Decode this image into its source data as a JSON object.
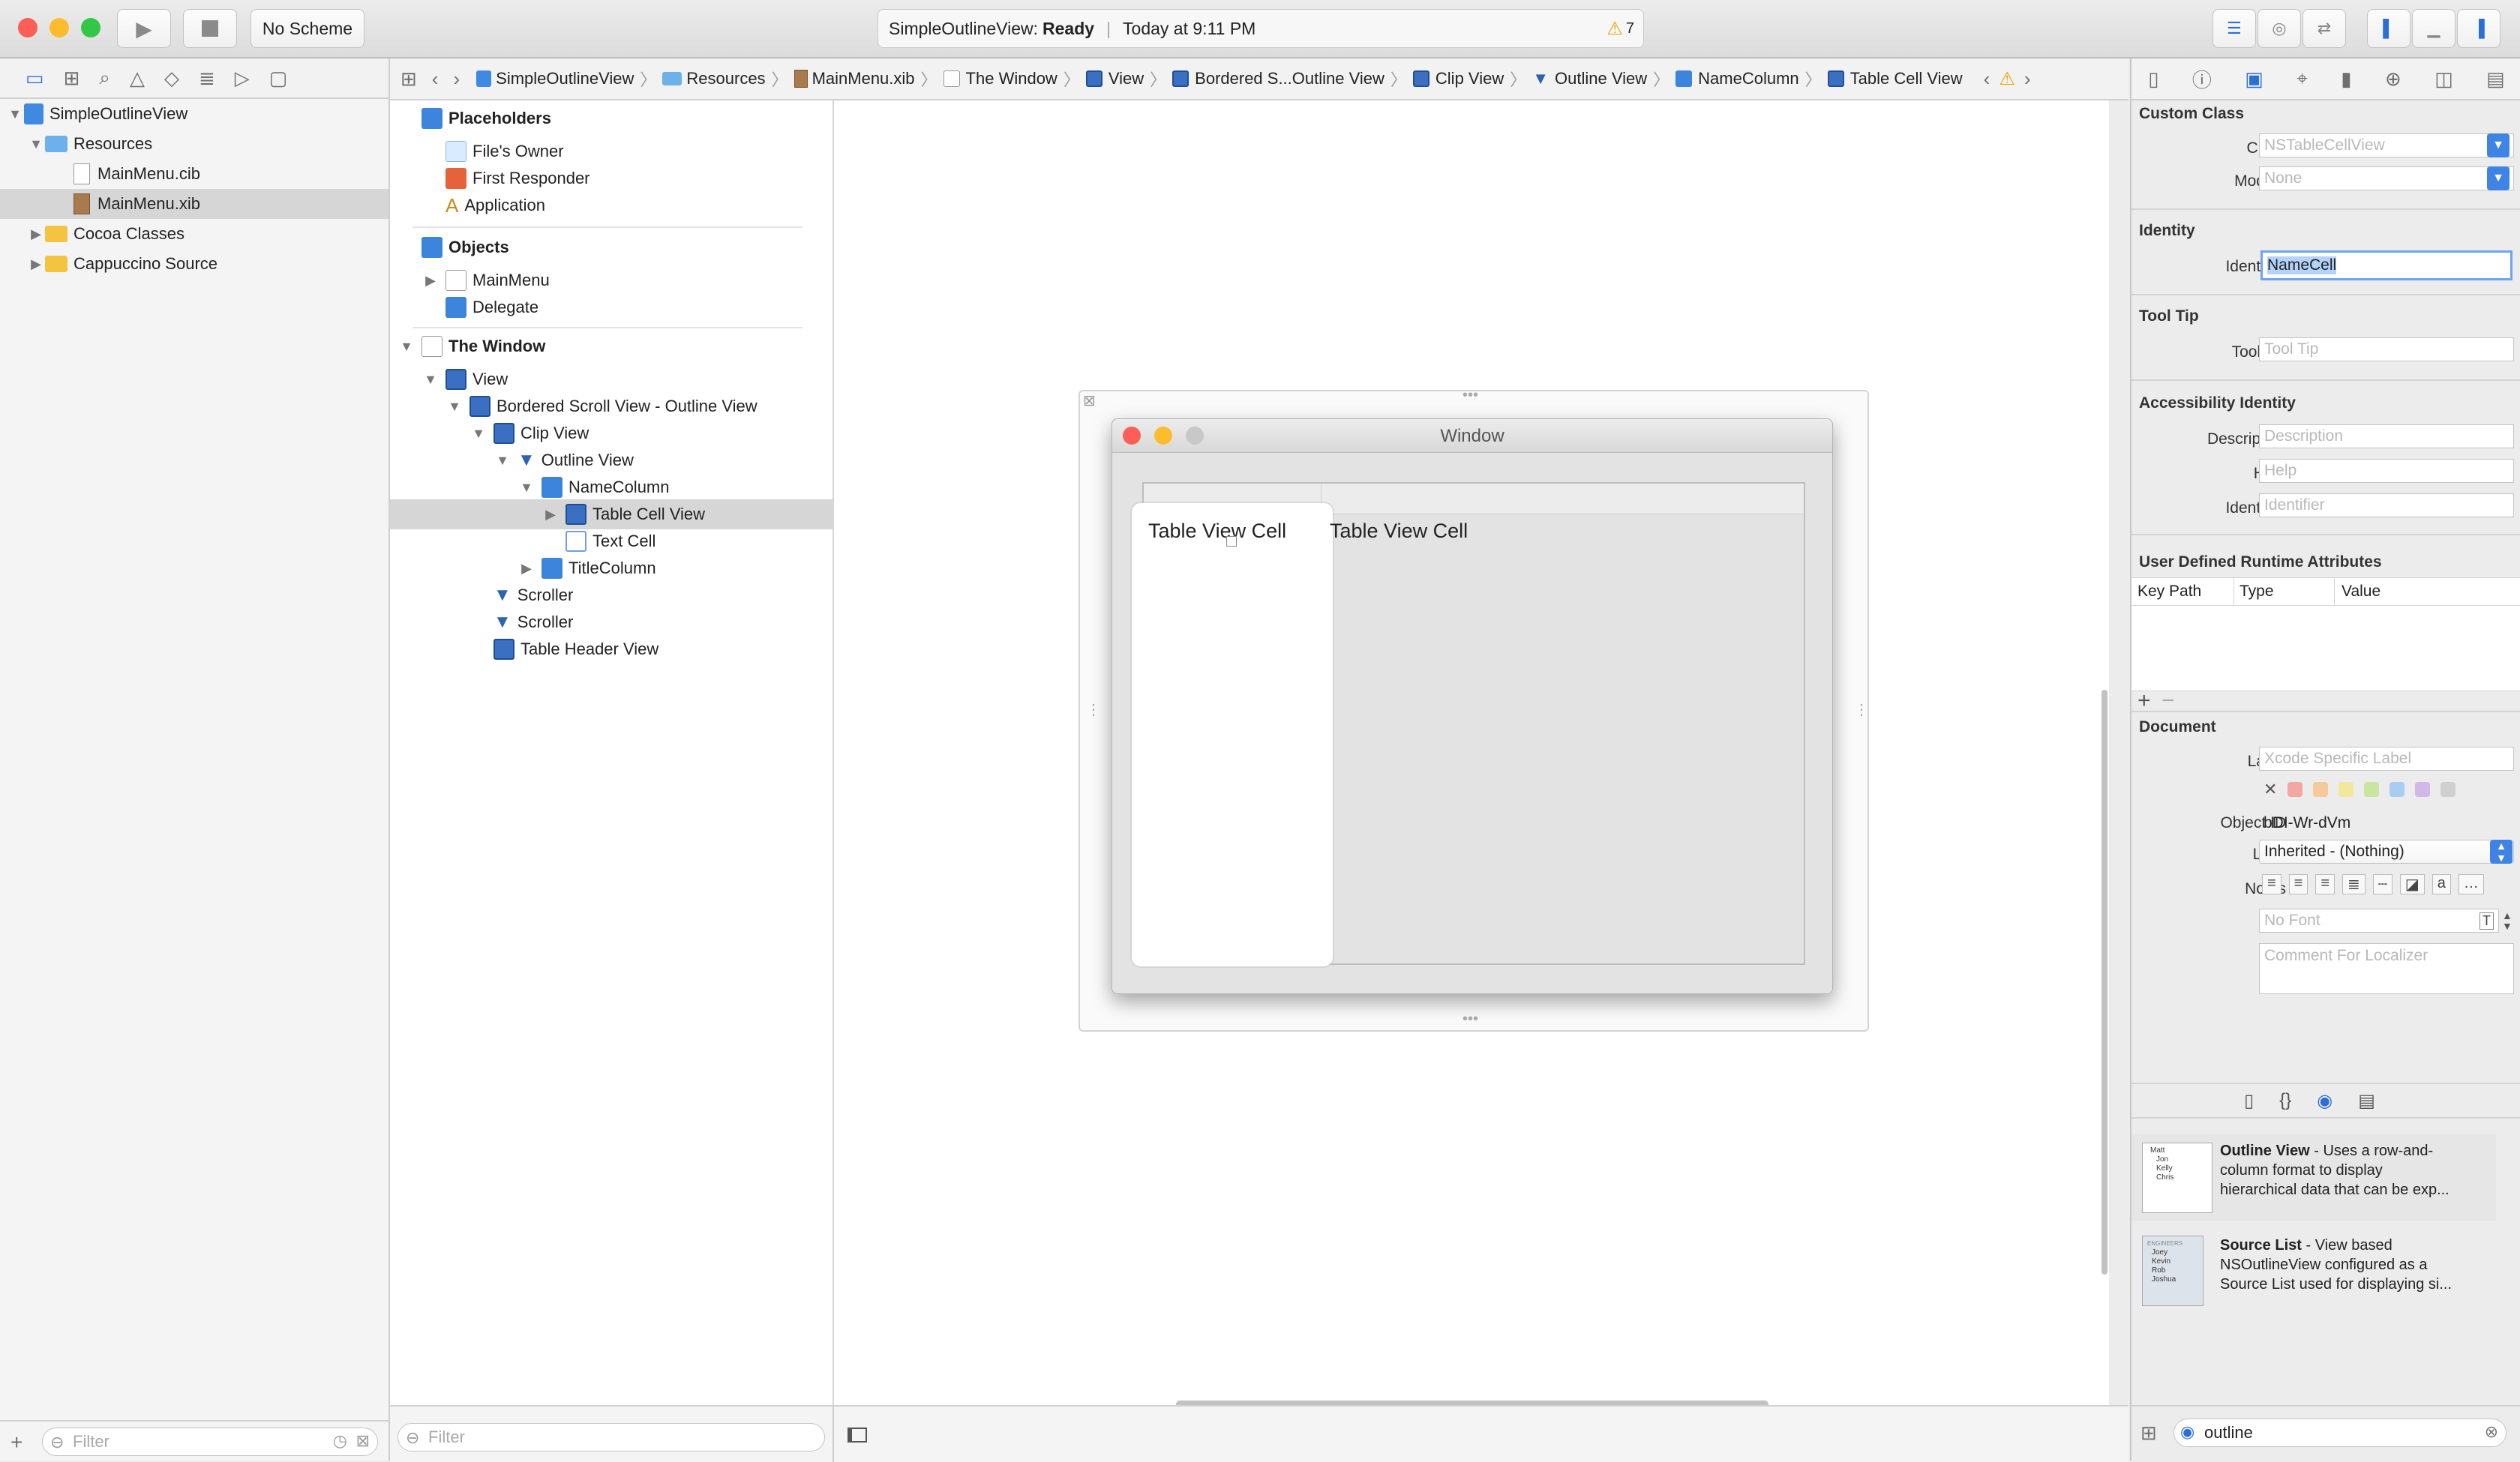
{
  "toolbar": {
    "run_icon": "play-icon",
    "stop_icon": "stop-icon",
    "scheme": "No Scheme",
    "status_project": "SimpleOutlineView:",
    "status_state": "Ready",
    "status_time": "Today at 9:11 PM",
    "warning_count": "7"
  },
  "navigator": {
    "filter_placeholder": "Filter",
    "items": [
      {
        "label": "SimpleOutlineView"
      },
      {
        "label": "Resources"
      },
      {
        "label": "MainMenu.cib"
      },
      {
        "label": "MainMenu.xib"
      },
      {
        "label": "Cocoa Classes"
      },
      {
        "label": "Cappuccino Source"
      }
    ]
  },
  "jumpbar": {
    "crumbs": [
      "SimpleOutlineView",
      "Resources",
      "MainMenu.xib",
      "The Window",
      "View",
      "Bordered S...Outline View",
      "Clip View",
      "Outline View",
      "NameColumn",
      "Table Cell View"
    ]
  },
  "outline": {
    "filter_placeholder": "Filter",
    "placeholders": "Placeholders",
    "files_owner": "File's Owner",
    "first_responder": "First Responder",
    "application": "Application",
    "objects": "Objects",
    "mainmenu": "MainMenu",
    "delegate": "Delegate",
    "the_window": "The Window",
    "view": "View",
    "bordered_scroll": "Bordered Scroll View - Outline View",
    "clip_view": "Clip View",
    "outline_view": "Outline View",
    "name_column": "NameColumn",
    "table_cell_view": "Table Cell View",
    "text_cell": "Text Cell",
    "title_column": "TitleColumn",
    "scroller1": "Scroller",
    "scroller2": "Scroller",
    "table_header_view": "Table Header View"
  },
  "canvas": {
    "window_title": "Window",
    "cell1": "Table View Cell",
    "cell2": "Table View Cell"
  },
  "inspector": {
    "custom_class": "Custom Class",
    "class_label": "Class",
    "class_placeholder": "NSTableCellView",
    "module_label": "Module",
    "module_placeholder": "None",
    "identity": "Identity",
    "identifier_label": "Identifier",
    "identifier_value": "NameCell",
    "tooltip_header": "Tool Tip",
    "tooltip_label": "Tool Tip",
    "tooltip_placeholder": "Tool Tip",
    "accessibility": "Accessibility Identity",
    "description_label": "Description",
    "description_placeholder": "Description",
    "help_label": "Help",
    "help_placeholder": "Help",
    "acc_identifier_label": "Identifier",
    "acc_identifier_placeholder": "Identifier",
    "udra": "User Defined Runtime Attributes",
    "col_keypath": "Key Path",
    "col_type": "Type",
    "col_value": "Value",
    "document": "Document",
    "label_label": "Label",
    "label_placeholder": "Xcode Specific Label",
    "object_id_label": "Object ID",
    "object_id_value": "bDI-Wr-dVm",
    "lock_label": "Lock",
    "lock_value": "Inherited - (Nothing)",
    "notes_label": "Notes",
    "font_placeholder": "No Font",
    "comment_placeholder": "Comment For Localizer",
    "label_colors": [
      "#f0a8a0",
      "#f5c99a",
      "#f2e79a",
      "#c8e6a0",
      "#a8cdf0",
      "#d0b8e8",
      "#cfcfcf"
    ]
  },
  "library": {
    "items": [
      {
        "title": "Outline View",
        "desc1": " - Uses a row-and-",
        "desc2": "column format to display",
        "desc3": "hierarchical data that can be exp..."
      },
      {
        "title": "Source List",
        "desc1": " - View based",
        "desc2": "NSOutlineView configured as a",
        "desc3": "Source List used for displaying si..."
      }
    ],
    "thumb1": [
      "Matt",
      "Jon",
      "Kelly",
      "Chris"
    ],
    "thumb2": [
      "ENGINEERS",
      "Joey",
      "Kevin",
      "Rob",
      "Joshua"
    ],
    "search_value": "outline"
  },
  "colors": {
    "accent": "#3f84e5",
    "selection": "#d6d6d6",
    "close": "#fc5f57",
    "minimize": "#fdbc2e",
    "zoom": "#33c748"
  }
}
